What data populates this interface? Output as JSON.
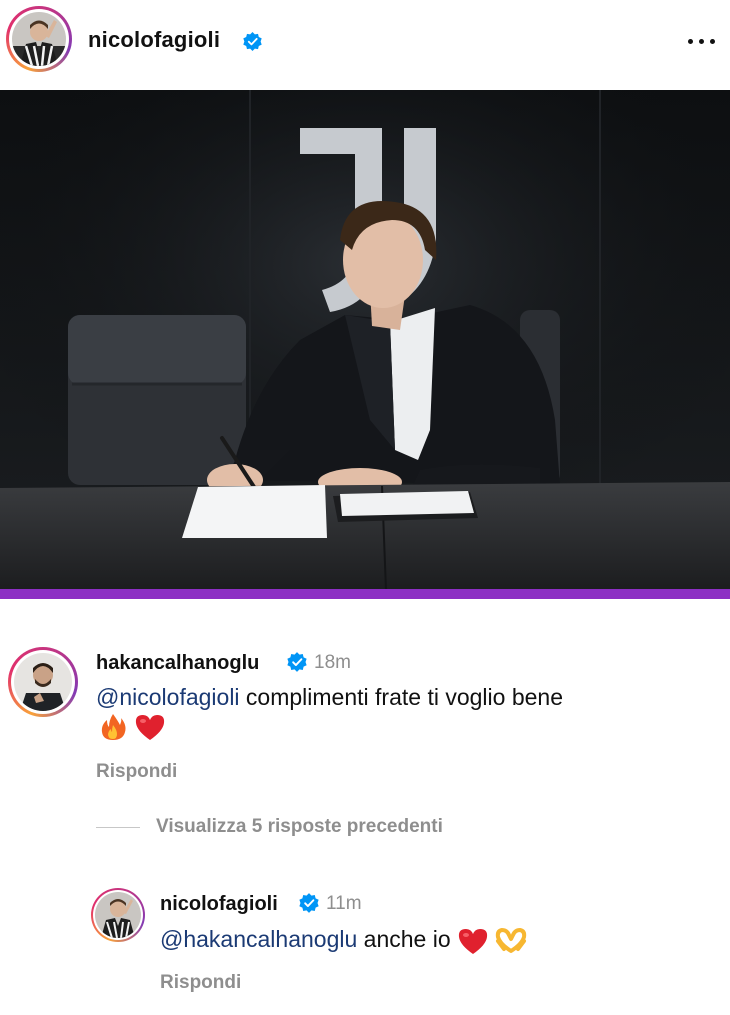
{
  "post": {
    "author": "nicolofagioli",
    "author_verified": true,
    "more_icon": "more-horizontal-icon"
  },
  "comments": [
    {
      "username": "hakancalhanoglu",
      "verified": true,
      "time": "18m",
      "mention": "@nicolofagioli",
      "text": " complimenti frate ti voglio bene",
      "emojis": [
        "fire-icon",
        "red-heart-icon"
      ],
      "reply_label": "Rispondi"
    }
  ],
  "view_replies_label": "Visualizza 5 risposte precedenti",
  "replies": [
    {
      "username": "nicolofagioli",
      "verified": true,
      "time": "11m",
      "mention": "@hakancalhanoglu",
      "text": " anche io ",
      "emojis": [
        "red-heart-icon",
        "heart-hands-icon"
      ],
      "reply_label": "Rispondi"
    }
  ],
  "colors": {
    "accent_purple": "#8d2fc4",
    "verified_blue": "#0095f6",
    "mention_blue": "#1b3a74",
    "secondary_text": "#8e8e8e"
  }
}
